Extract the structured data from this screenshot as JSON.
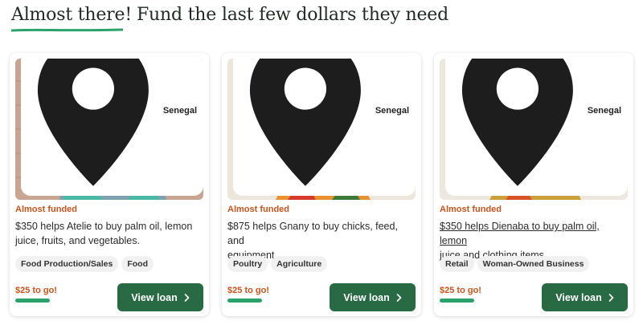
{
  "heading": {
    "emphasis": "Almost there!",
    "rest": "Fund the last few dollars they need"
  },
  "colors": {
    "primary_button": "#276a43",
    "status_text": "#c8541d",
    "progress": "#2aa36a",
    "heading_underline": "#2aa36a"
  },
  "cards": [
    {
      "location": "Senegal",
      "status": "Almost funded",
      "description_line1": "$350 helps Atelie to buy palm oil, lemon",
      "description_line2": "juice, fruits, and vegetables.",
      "tags": [
        "Food Production/Sales",
        "Food"
      ],
      "to_go": "$25 to go!",
      "button_label": "View loan",
      "icon": "map-pin-icon"
    },
    {
      "location": "Senegal",
      "status": "Almost funded",
      "description_line1": "$875 helps Gnany to buy chicks, feed, and",
      "description_line2": "equipment.",
      "tags": [
        "Poultry",
        "Agriculture"
      ],
      "to_go": "$25 to go!",
      "button_label": "View loan",
      "icon": "map-pin-icon"
    },
    {
      "location": "Senegal",
      "status": "Almost funded",
      "description_line1": "$350 helps Dienaba to buy palm oil, lemon",
      "description_line2": "juice and clothing items.",
      "tags": [
        "Retail",
        "Woman-Owned Business"
      ],
      "to_go": "$25 to go!",
      "button_label": "View loan",
      "icon": "map-pin-icon"
    }
  ]
}
